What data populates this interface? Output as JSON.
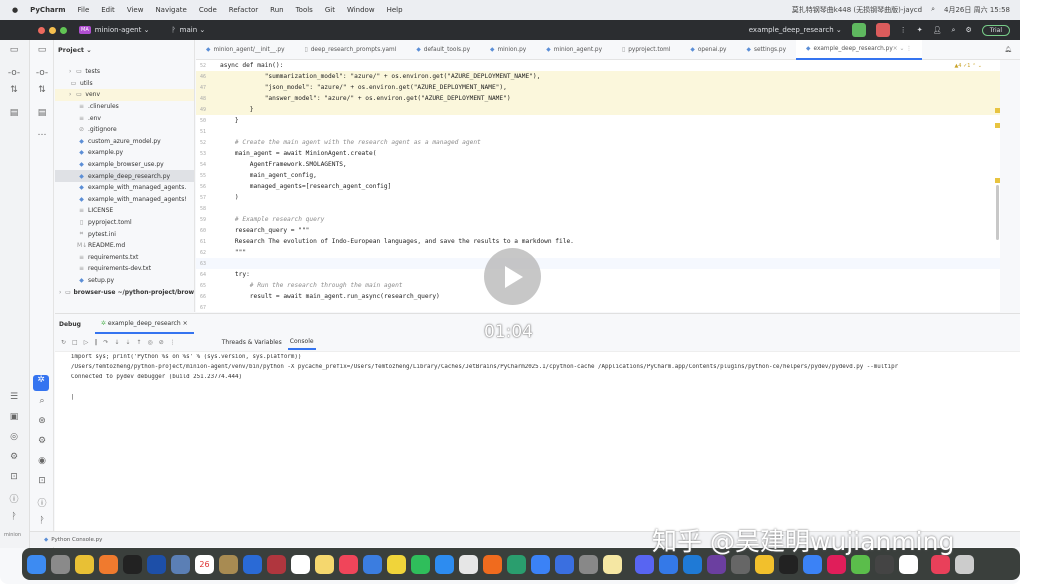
{
  "menubar": {
    "app": "PyCharm",
    "items": [
      "File",
      "Edit",
      "View",
      "Navigate",
      "Code",
      "Refactor",
      "Run",
      "Tools",
      "Git",
      "Window",
      "Help"
    ],
    "song": "莫扎特钢琴曲k448 (无损钢琴曲版)-jaycd",
    "datetime": "4月26日 周六 15:58"
  },
  "titlebar": {
    "project_badge": "MA",
    "project": "minion-agent ⌄",
    "branch": "main ⌄",
    "run_config": "example_deep_research ⌄",
    "trial": "Trial"
  },
  "project": {
    "title": "Project ⌄",
    "items": [
      {
        "name": "tests",
        "icon": "folder",
        "indent": 1,
        "arrow": true
      },
      {
        "name": "utils",
        "icon": "folder",
        "indent": 1
      },
      {
        "name": "venv",
        "icon": "folder",
        "indent": 1,
        "arrow": true,
        "hl": true
      },
      {
        "name": ".clinerules",
        "icon": "text"
      },
      {
        "name": ".env",
        "icon": "text"
      },
      {
        "name": ".gitignore",
        "icon": "ignore"
      },
      {
        "name": "custom_azure_model.py",
        "icon": "python"
      },
      {
        "name": "example.py",
        "icon": "python"
      },
      {
        "name": "example_browser_use.py",
        "icon": "python"
      },
      {
        "name": "example_deep_research.py",
        "icon": "python",
        "sel": true
      },
      {
        "name": "example_with_managed_agents.",
        "icon": "python"
      },
      {
        "name": "example_with_managed_agents!",
        "icon": "python"
      },
      {
        "name": "LICENSE",
        "icon": "text"
      },
      {
        "name": "pyproject.toml",
        "icon": "toml"
      },
      {
        "name": "pytest.ini",
        "icon": "ini"
      },
      {
        "name": "README.md",
        "icon": "md"
      },
      {
        "name": "requirements.txt",
        "icon": "text"
      },
      {
        "name": "requirements-dev.txt",
        "icon": "text"
      },
      {
        "name": "setup.py",
        "icon": "python"
      },
      {
        "name": "browser-use  ~/python-project/brow",
        "icon": "folder",
        "root": true,
        "arrow": true
      }
    ]
  },
  "tabs": [
    "minion_agent/__init__.py",
    "deep_research_prompts.yaml",
    "default_tools.py",
    "minion.py",
    "minion_agent.py",
    "pyproject.toml",
    "openai.py",
    "settings.py",
    "example_deep_research.py"
  ],
  "active_tab": 8,
  "editor": {
    "sticky": "async def main():",
    "inspection": "▲4 ✓1 ⌃ ⌄",
    "lines": [
      {
        "n": "46",
        "t": "            \"summarization_model\": \"azure/\" + os.environ.get(\"AZURE_DEPLOYMENT_NAME\"),",
        "y": true
      },
      {
        "n": "47",
        "t": "            \"json_model\": \"azure/\" + os.environ.get(\"AZURE_DEPLOYMENT_NAME\"),",
        "y": true
      },
      {
        "n": "48",
        "t": "            \"answer_model\": \"azure/\" + os.environ.get(\"AZURE_DEPLOYMENT_NAME\")",
        "y": true
      },
      {
        "n": "49",
        "t": "        }",
        "y": true
      },
      {
        "n": "50",
        "t": "    }"
      },
      {
        "n": "51",
        "t": ""
      },
      {
        "n": "52",
        "t": "    # Create the main agent with the research agent as a managed agent",
        "c": true
      },
      {
        "n": "53",
        "t": "    main_agent = await MinionAgent.create("
      },
      {
        "n": "54",
        "t": "        AgentFramework.SMOLAGENTS,"
      },
      {
        "n": "55",
        "t": "        main_agent_config,"
      },
      {
        "n": "56",
        "t": "        managed_agents=[research_agent_config]"
      },
      {
        "n": "57",
        "t": "    )"
      },
      {
        "n": "58",
        "t": ""
      },
      {
        "n": "59",
        "t": "    # Example research query",
        "c": true
      },
      {
        "n": "60",
        "t": "    research_query = \"\"\""
      },
      {
        "n": "61",
        "t": "    Research The evolution of Indo-European languages, and save the results to a markdown file."
      },
      {
        "n": "62",
        "t": "    \"\"\""
      },
      {
        "n": "63",
        "t": "",
        "cur": true
      },
      {
        "n": "64",
        "t": "    try:"
      },
      {
        "n": "65",
        "t": "        # Run the research through the main agent",
        "c": true
      },
      {
        "n": "66",
        "t": "        result = await main_agent.run_async(research_query)"
      },
      {
        "n": "67",
        "t": ""
      }
    ]
  },
  "debug": {
    "title": "Debug",
    "session": "example_deep_research",
    "tabs": [
      "Threads & Variables",
      "Console"
    ],
    "active_tab": 1,
    "console": [
      "import sys; print('Python %s on %s' % (sys.version, sys.platform))",
      "/Users/femtozheng/python-project/minion-agent/venv/bin/python -X pycache_prefix=/Users/femtozheng/Library/Caches/JetBrains/PyCharm2025.1/cpython-cache /Applications/PyCharm.app/Contents/plugins/python-ce/helpers/pydev/pydevd.py --multipr",
      "Connected to pydev debugger (build 251.23774.444)",
      "",
      "|"
    ]
  },
  "status": {
    "breadcrumb": "Python Console.py",
    "left": "minion"
  },
  "video": {
    "time": "01:04"
  },
  "watermark": "知乎 @吴建明wujianming",
  "dock": {
    "calendar_day": "26",
    "colors": [
      "#3d8bf2",
      "#8a8a8a",
      "#e8c035",
      "#f07a2e",
      "#222",
      "#1d4fa8",
      "#5b7fb5",
      "#fff",
      "#a88b52",
      "#2a6ad6",
      "#b0363e",
      "#fff",
      "#f5d76e",
      "#f0455a",
      "#3b7de0",
      "#f0d43a",
      "#2fbe5b",
      "#2d8cf0",
      "#e6e6e6",
      "#f06b1e",
      "#2a9e6e",
      "#3b82f6",
      "#3a6fe0",
      "#888",
      "#f5e7a3",
      "#5865f2",
      "#3479e8",
      "#1f7ad6",
      "#6b3fa0",
      "#666",
      "#f2c02c",
      "#222",
      "#3b82f6",
      "#e01e5a",
      "#5bbd4b",
      "#444",
      "#fff",
      "#e9405a",
      "#ccc"
    ]
  },
  "colors": {
    "accent": "#3574f0",
    "highlight": "#fbf7dc",
    "titlebar": "#2b2d30"
  }
}
